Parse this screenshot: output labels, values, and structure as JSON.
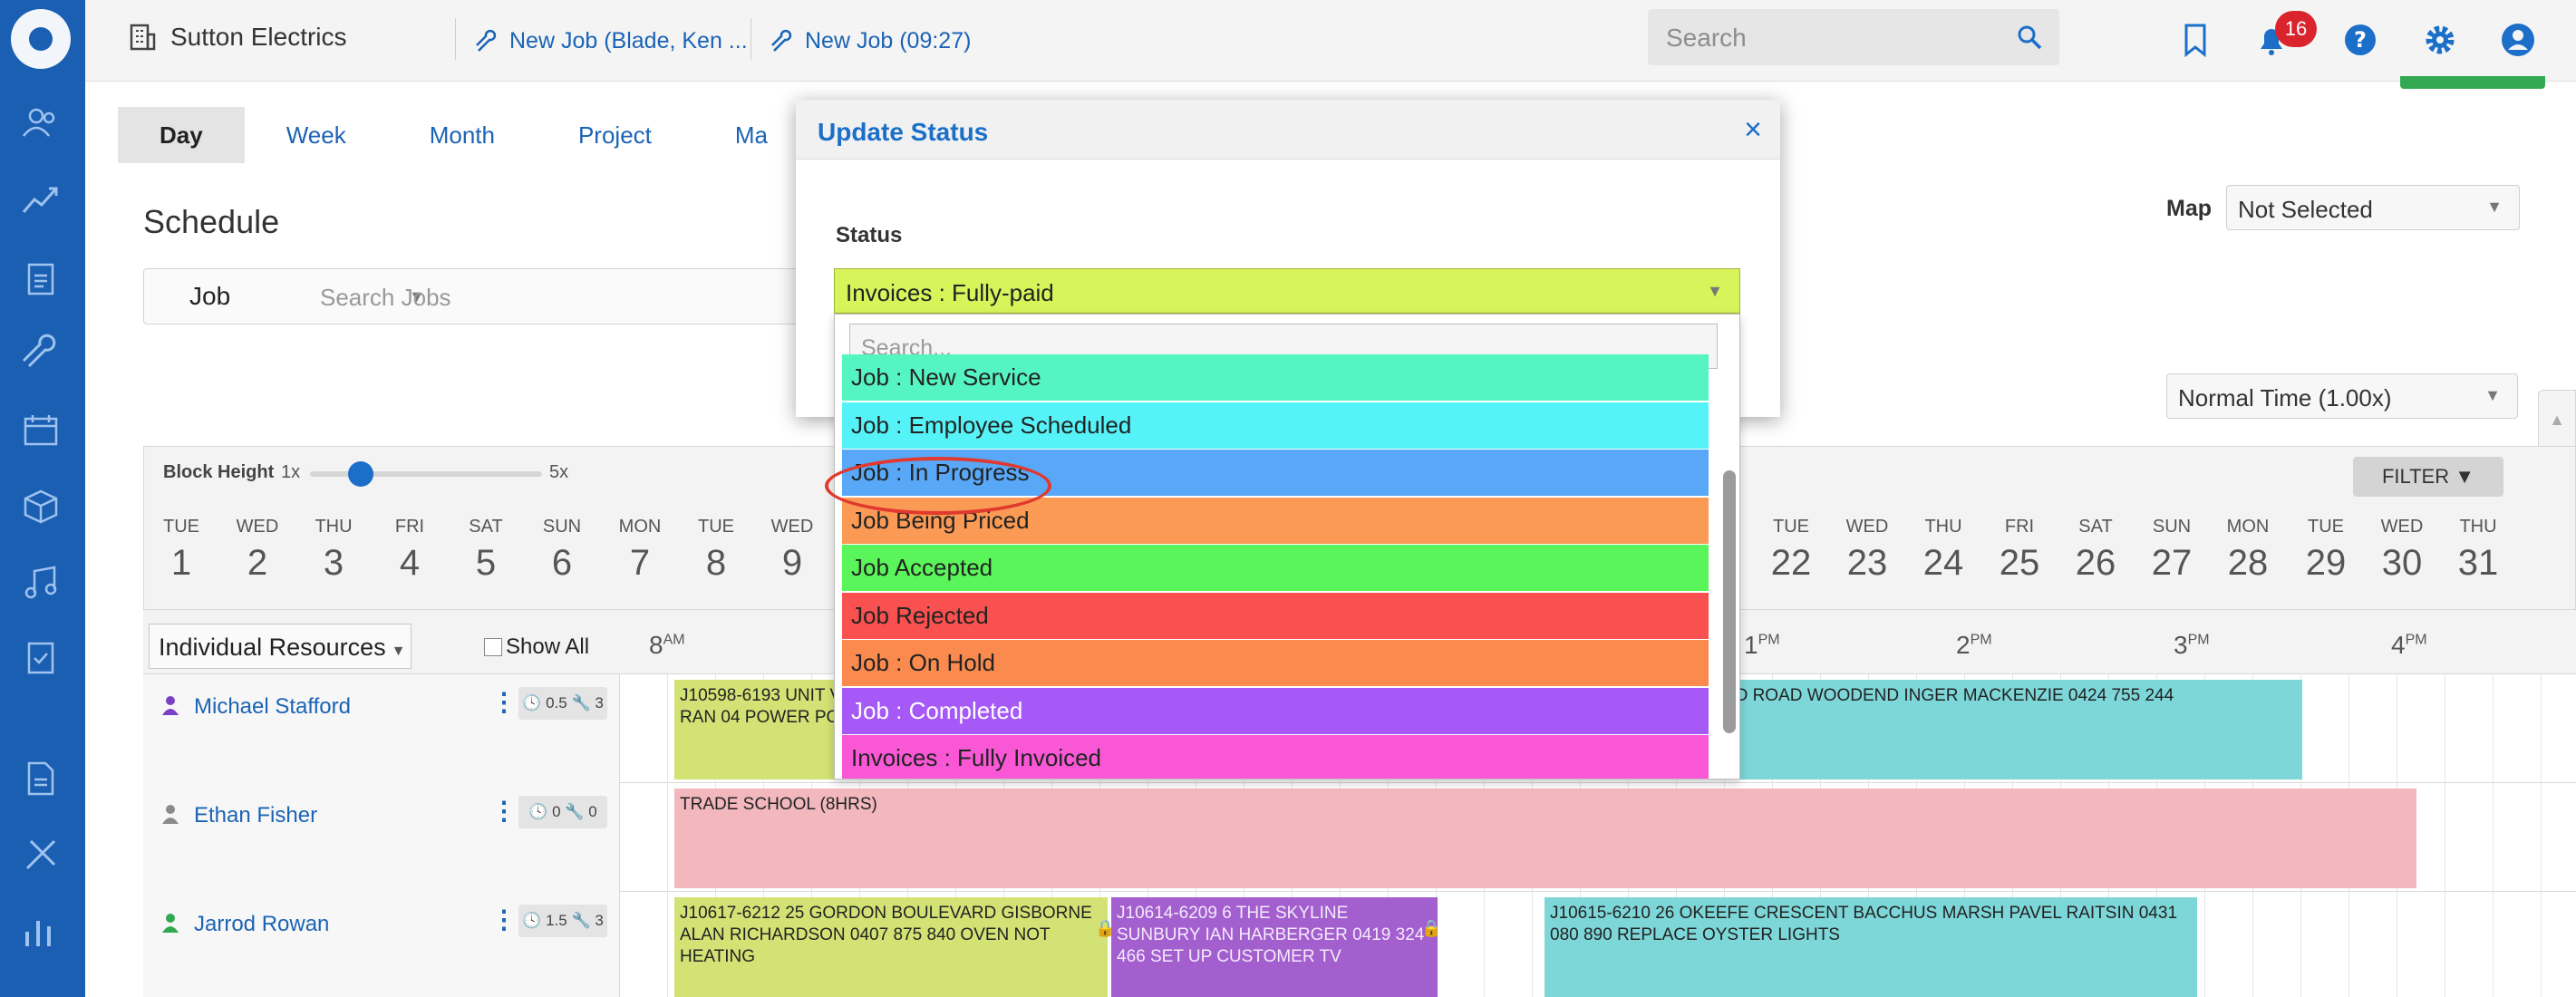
{
  "header": {
    "company": "Sutton Electrics",
    "breadcrumbs": [
      "New Job (Blade, Ken ...",
      "New Job (09:27)"
    ],
    "search_placeholder": "Search",
    "notification_count": "16"
  },
  "view_tabs": [
    "Day",
    "Week",
    "Month",
    "Project",
    "Ma"
  ],
  "schedule": {
    "title": "Schedule",
    "search_type": "Job",
    "search_placeholder": "Search Jobs",
    "map_label": "Map",
    "map_value": "Not Selected",
    "time_value": "Normal Time (1.00x)",
    "block_height_label": "Block Height",
    "block_min": "1x",
    "block_max": "5x",
    "block_level_fraction": 0.22,
    "filter_label": "FILTER ▼",
    "resources_select": "Individual Resources",
    "show_all": "Show All"
  },
  "days": [
    {
      "dn": "TUE",
      "dd": "1"
    },
    {
      "dn": "WED",
      "dd": "2"
    },
    {
      "dn": "THU",
      "dd": "3"
    },
    {
      "dn": "FRI",
      "dd": "4"
    },
    {
      "dn": "SAT",
      "dd": "5"
    },
    {
      "dn": "SUN",
      "dd": "6"
    },
    {
      "dn": "MON",
      "dd": "7"
    },
    {
      "dn": "TUE",
      "dd": "8"
    },
    {
      "dn": "WED",
      "dd": "9"
    },
    {
      "dn": "TUE",
      "dd": "22"
    },
    {
      "dn": "WED",
      "dd": "23"
    },
    {
      "dn": "THU",
      "dd": "24"
    },
    {
      "dn": "FRI",
      "dd": "25"
    },
    {
      "dn": "SAT",
      "dd": "26"
    },
    {
      "dn": "SUN",
      "dd": "27"
    },
    {
      "dn": "MON",
      "dd": "28"
    },
    {
      "dn": "TUE",
      "dd": "29"
    },
    {
      "dn": "WED",
      "dd": "30"
    },
    {
      "dn": "THU",
      "dd": "31"
    }
  ],
  "hours": [
    {
      "h": "8",
      "ap": "AM"
    },
    {
      "h": "1",
      "ap": "PM"
    },
    {
      "h": "2",
      "ap": "PM"
    },
    {
      "h": "3",
      "ap": "PM"
    },
    {
      "h": "4",
      "ap": "PM"
    }
  ],
  "resources": [
    {
      "name": "Michael Stafford",
      "hours": "0.5",
      "jobs": "3",
      "icon_color": "#7b3fc4"
    },
    {
      "name": "Ethan Fisher",
      "hours": "0",
      "jobs": "0",
      "icon_color": "#8a8a8a"
    },
    {
      "name": "Jarrod Rowan",
      "hours": "1.5",
      "jobs": "3",
      "icon_color": "#33a852"
    }
  ],
  "jobs": {
    "r0a": "J10598-6193 UNIT VALE VIJAY RAN 04 POWER POINT + DA",
    "r0b": "LD ROAD WOODEND INGER MACKENZIE 0424 755 244",
    "r1a": "TRADE SCHOOL (8HRS)",
    "r2a": "J10617-6212 25 GORDON BOULEVARD GISBORNE ALAN RICHARDSON 0407 875 840 OVEN NOT HEATING",
    "r2b": "J10614-6209 6 THE SKYLINE SUNBURY IAN HARBERGER 0419 324 466 SET UP CUSTOMER TV",
    "r2c": "J10615-6210 26 OKEEFE CRESCENT BACCHUS MARSH PAVEL RAITSIN 0431 080 890 REPLACE OYSTER LIGHTS"
  },
  "modal": {
    "title": "Update Status",
    "close": "×",
    "status_label": "Status",
    "selected": "Invoices : Fully-paid",
    "search_placeholder": "Search...",
    "options": [
      {
        "label": "Job : New Service",
        "color": "#55f5c2"
      },
      {
        "label": "Job : Employee Scheduled",
        "color": "#55f3f7"
      },
      {
        "label": "Job : In Progress",
        "color": "#58a8f7"
      },
      {
        "label": "Job Being Priced",
        "color": "#fb9a55"
      },
      {
        "label": "Job Accepted",
        "color": "#5af55a"
      },
      {
        "label": "Job Rejected",
        "color": "#f9514f"
      },
      {
        "label": "Job : On Hold",
        "color": "#fb8a4e"
      },
      {
        "label": "Job : Completed",
        "color": "#a659f7"
      },
      {
        "label": "Invoices : Fully Invoiced",
        "color": "#f957d6"
      }
    ]
  },
  "colors": {
    "brand": "#1b5fb3",
    "accent": "#1b6fc8",
    "selected_status": "#d7f45a",
    "job_olive": "#d3e274",
    "job_teal": "#7dd6d8",
    "job_pink": "#f2b8bd",
    "job_purple": "#a45fcf"
  }
}
